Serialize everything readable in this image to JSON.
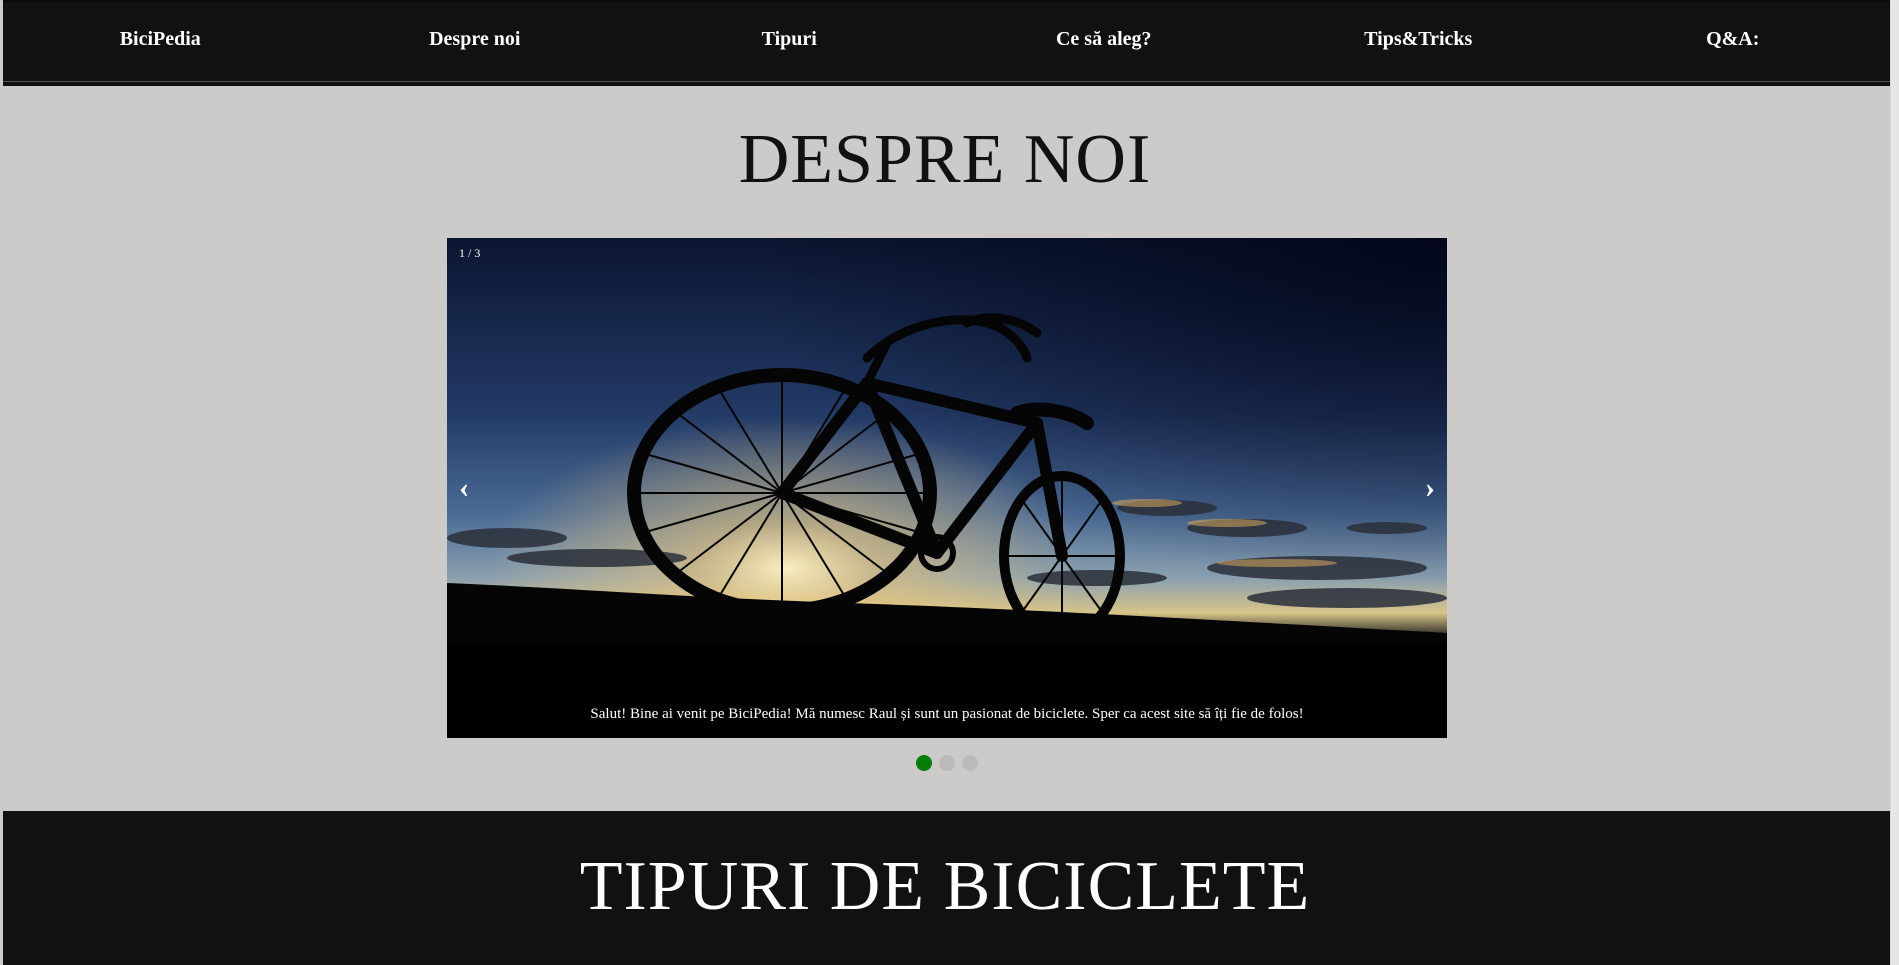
{
  "nav": {
    "items": [
      {
        "label": "BiciPedia"
      },
      {
        "label": "Despre noi"
      },
      {
        "label": "Tipuri"
      },
      {
        "label": "Ce să aleg?"
      },
      {
        "label": "Tips&Tricks"
      },
      {
        "label": "Q&A:"
      }
    ]
  },
  "about": {
    "title": "DESPRE NOI"
  },
  "slideshow": {
    "counter": "1 / 3",
    "caption": "Salut! Bine ai venit pe BiciPedia! Mă numesc Raul și sunt un pasionat de biciclete. Sper ca acest site să îți fie de folos!",
    "prev_icon": "‹",
    "next_icon": "›",
    "image": "bicycle-silhouette-sunset",
    "active_dot_color": "#097c0a",
    "dot_color": "#bbbbbb",
    "dots_count": 3,
    "active_dot": 1
  },
  "types": {
    "title": "TIPURI DE BICICLETE"
  },
  "colors": {
    "background": "#cccbca",
    "nav_background": "#111111",
    "nav_text": "#ffffff"
  }
}
